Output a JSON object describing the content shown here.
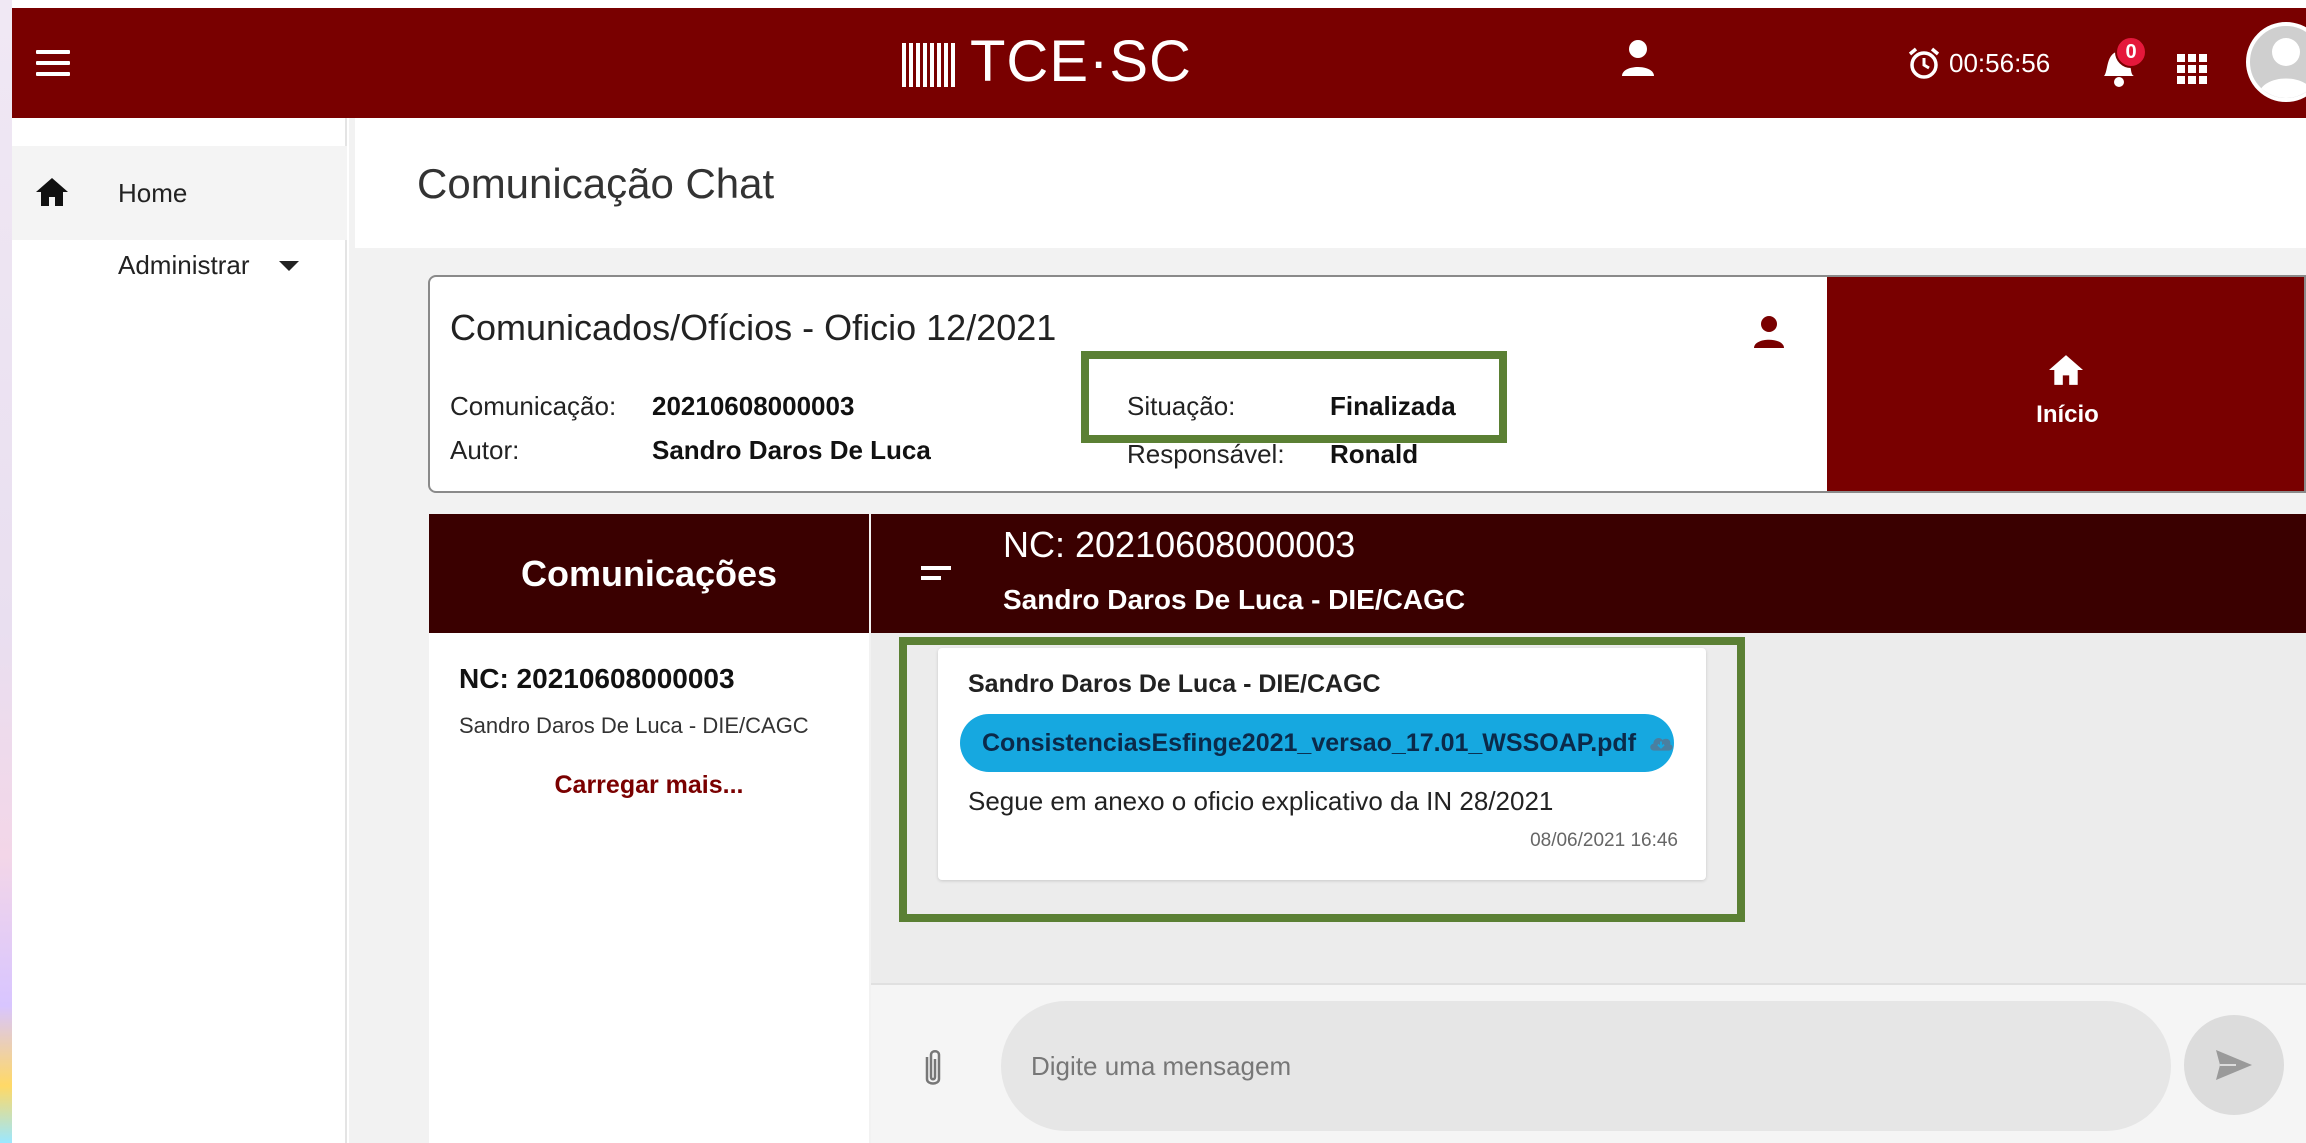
{
  "header": {
    "logo_text": "TCE·SC",
    "timer": "00:56:56",
    "notifications_count": "0"
  },
  "sidebar": {
    "items": [
      {
        "label": "Home",
        "icon": "home-icon"
      },
      {
        "label": "Administrar",
        "icon": "caret-down-icon"
      }
    ]
  },
  "page": {
    "title": "Comunicação Chat"
  },
  "info": {
    "title": "Comunicados/Ofícios - Oficio 12/2021",
    "comunicacao_label": "Comunicação:",
    "comunicacao_value": "20210608000003",
    "autor_label": "Autor:",
    "autor_value": "Sandro Daros De Luca",
    "situacao_label": "Situação:",
    "situacao_value": "Finalizada",
    "responsavel_label": "Responsável:",
    "responsavel_value": "Ronald",
    "inicio_label": "Início"
  },
  "chat": {
    "list_title": "Comunicações",
    "header_nc": "NC: 20210608000003",
    "header_author": "Sandro Daros De Luca - DIE/CAGC",
    "conversations": [
      {
        "nc": "NC: 20210608000003",
        "author": "Sandro Daros De Luca - DIE/CAGC"
      }
    ],
    "load_more": "Carregar mais...",
    "messages": [
      {
        "sender": "Sandro Daros De Luca - DIE/CAGC",
        "file": "ConsistenciasEsfinge2021_versao_17.01_WSSOAP.pdf",
        "text": "Segue em anexo o oficio explicativo da IN 28/2021",
        "time": "08/06/2021 16:46"
      }
    ],
    "input_placeholder": "Digite uma mensagem"
  },
  "colors": {
    "brand": "#790000",
    "chat_header": "#3a0000",
    "highlight": "#5b8034",
    "file_chip": "#16a8e0",
    "badge": "#e5183b"
  }
}
